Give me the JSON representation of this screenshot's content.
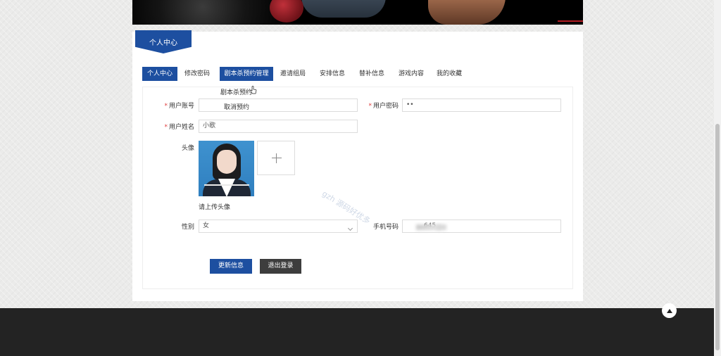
{
  "ribbon": {
    "title": "个人中心"
  },
  "tabs": [
    {
      "label": "个人中心",
      "active": true
    },
    {
      "label": "修改密码"
    },
    {
      "label": "剧本杀预约管理",
      "highlighted": true
    },
    {
      "label": "邀请组局"
    },
    {
      "label": "安排信息"
    },
    {
      "label": "替补信息"
    },
    {
      "label": "游戏内容"
    },
    {
      "label": "我的收藏"
    }
  ],
  "dropdown": {
    "items": [
      {
        "label": "剧本杀预约"
      },
      {
        "label": "取消预约"
      }
    ]
  },
  "form": {
    "account": {
      "label": "用户账号",
      "value": ""
    },
    "password": {
      "label": "用户密码",
      "value": "••"
    },
    "name": {
      "label": "用户姓名",
      "value": "小歌"
    },
    "avatar": {
      "label": "头像",
      "hint": "请上传头像"
    },
    "gender": {
      "label": "性别",
      "value": "女"
    },
    "phone": {
      "label": "手机号码",
      "value_visible": "645"
    }
  },
  "buttons": {
    "update": "更新信息",
    "logout": "退出登录"
  },
  "watermark": "gzh 源码好优多",
  "colors": {
    "primary": "#1d4fa0",
    "dark_button": "#3d3d3d",
    "footer": "#232323",
    "required": "#e03c3c"
  }
}
